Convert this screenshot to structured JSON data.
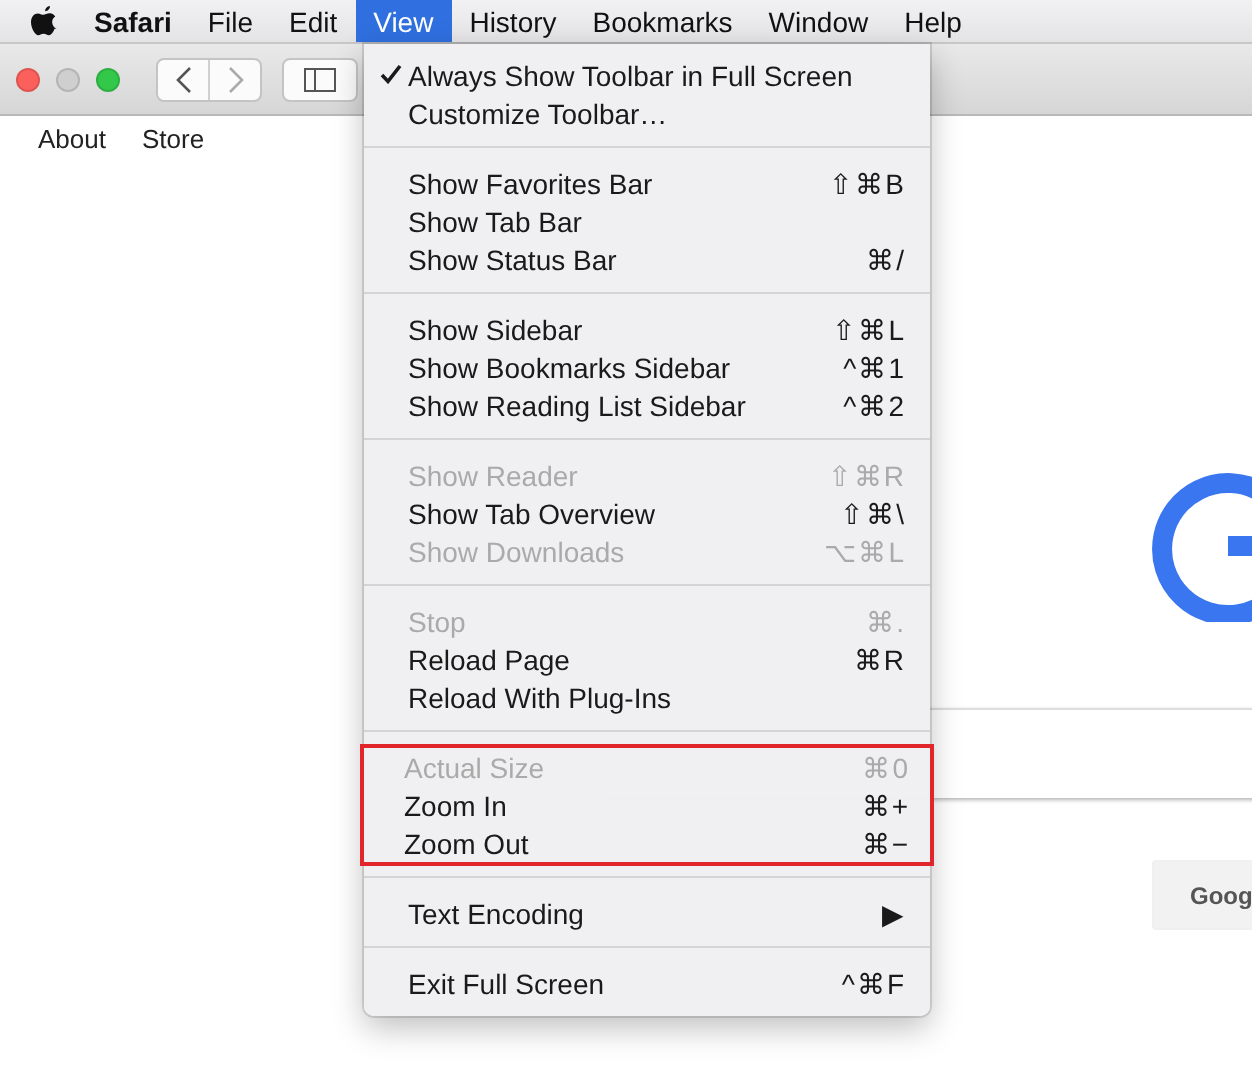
{
  "menubar": {
    "app": "Safari",
    "items": [
      {
        "label": "File",
        "selected": false
      },
      {
        "label": "Edit",
        "selected": false
      },
      {
        "label": "View",
        "selected": true
      },
      {
        "label": "History",
        "selected": false
      },
      {
        "label": "Bookmarks",
        "selected": false
      },
      {
        "label": "Window",
        "selected": false
      },
      {
        "label": "Help",
        "selected": false
      }
    ]
  },
  "page": {
    "links": [
      "About",
      "Store"
    ],
    "button": "Goog"
  },
  "menu": {
    "sections": [
      {
        "highlighted": false,
        "items": [
          {
            "label": "Always Show Toolbar in Full Screen",
            "checked": true,
            "disabled": false
          },
          {
            "label": "Customize Toolbar…",
            "checked": false,
            "disabled": false
          }
        ]
      },
      {
        "highlighted": false,
        "items": [
          {
            "label": "Show Favorites Bar",
            "shortcut": "⇧⌘B",
            "checked": false,
            "disabled": false
          },
          {
            "label": "Show Tab Bar",
            "checked": false,
            "disabled": false
          },
          {
            "label": "Show Status Bar",
            "shortcut": "⌘/",
            "checked": false,
            "disabled": false
          }
        ]
      },
      {
        "highlighted": false,
        "items": [
          {
            "label": "Show Sidebar",
            "shortcut": "⇧⌘L",
            "checked": false,
            "disabled": false
          },
          {
            "label": "Show Bookmarks Sidebar",
            "shortcut": "^⌘1",
            "checked": false,
            "disabled": false
          },
          {
            "label": "Show Reading List Sidebar",
            "shortcut": "^⌘2",
            "checked": false,
            "disabled": false
          }
        ]
      },
      {
        "highlighted": false,
        "items": [
          {
            "label": "Show Reader",
            "shortcut": "⇧⌘R",
            "checked": false,
            "disabled": true
          },
          {
            "label": "Show Tab Overview",
            "shortcut": "⇧⌘\\",
            "checked": false,
            "disabled": false
          },
          {
            "label": "Show Downloads",
            "shortcut": "⌥⌘L",
            "checked": false,
            "disabled": true
          }
        ]
      },
      {
        "highlighted": false,
        "items": [
          {
            "label": "Stop",
            "shortcut": "⌘.",
            "checked": false,
            "disabled": true
          },
          {
            "label": "Reload Page",
            "shortcut": "⌘R",
            "checked": false,
            "disabled": false
          },
          {
            "label": "Reload With Plug-Ins",
            "checked": false,
            "disabled": false
          }
        ]
      },
      {
        "highlighted": true,
        "items": [
          {
            "label": "Actual Size",
            "shortcut": "⌘0",
            "checked": false,
            "disabled": true
          },
          {
            "label": "Zoom In",
            "shortcut": "⌘+",
            "checked": false,
            "disabled": false
          },
          {
            "label": "Zoom Out",
            "shortcut": "⌘−",
            "checked": false,
            "disabled": false
          }
        ]
      },
      {
        "highlighted": false,
        "items": [
          {
            "label": "Text Encoding",
            "shortcut": "▶",
            "checked": false,
            "disabled": false
          }
        ]
      },
      {
        "highlighted": false,
        "items": [
          {
            "label": "Exit Full Screen",
            "shortcut": "^⌘F",
            "checked": false,
            "disabled": false
          }
        ]
      }
    ]
  }
}
